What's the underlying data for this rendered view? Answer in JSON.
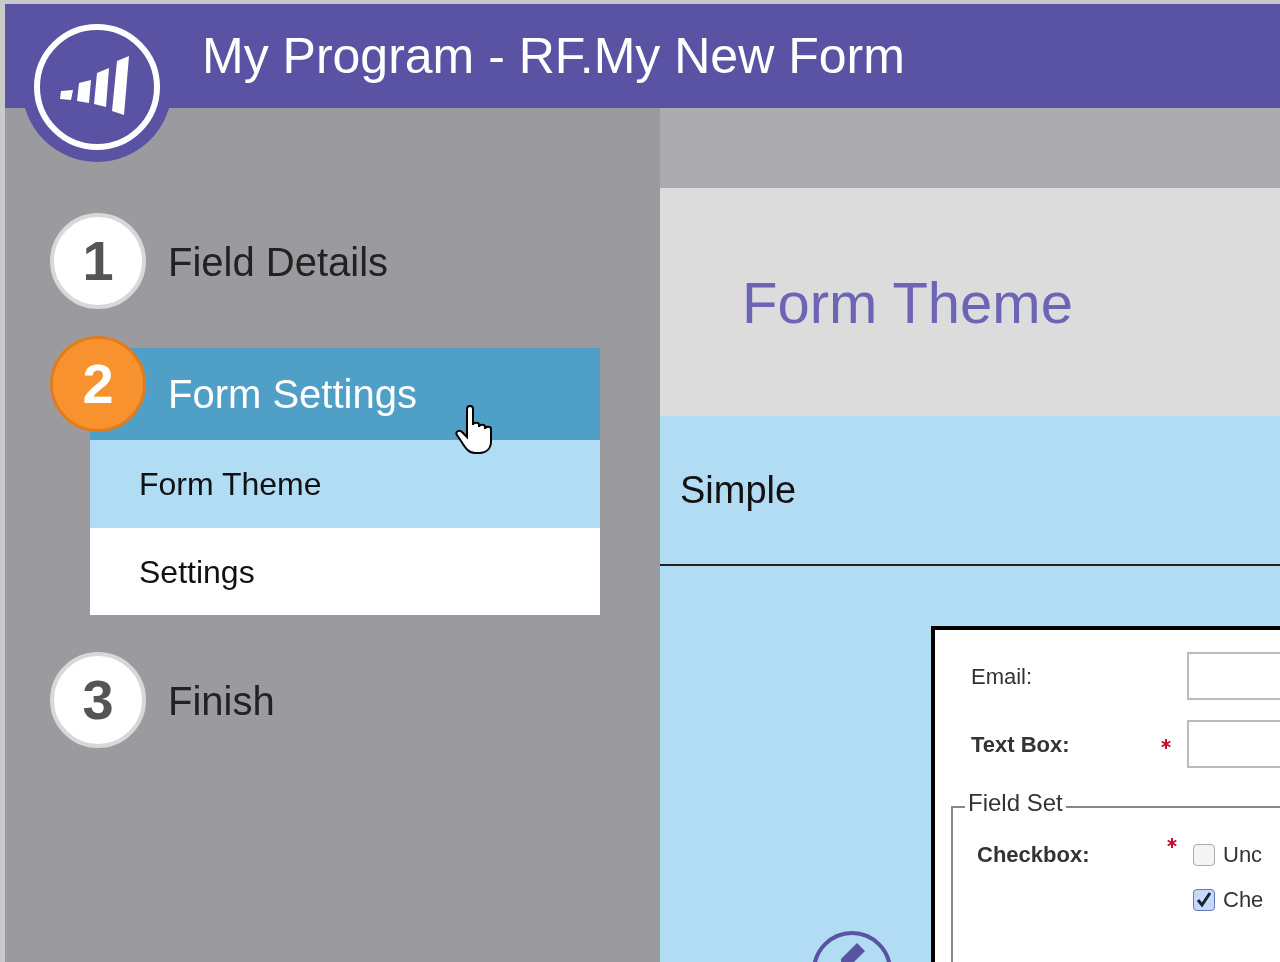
{
  "header": {
    "title": "My Program - RF.My New Form"
  },
  "steps": [
    {
      "number": "1",
      "label": "Field Details",
      "selected": false
    },
    {
      "number": "2",
      "label": "Form Settings",
      "selected": true,
      "children": [
        {
          "label": "Form Theme",
          "selected": true
        },
        {
          "label": "Settings",
          "selected": false
        }
      ]
    },
    {
      "number": "3",
      "label": "Finish",
      "selected": false
    }
  ],
  "panel": {
    "title": "Form Theme",
    "theme_name": "Simple"
  },
  "form_preview": {
    "fields": [
      {
        "label": "Email:",
        "required": false
      },
      {
        "label": "Text Box:",
        "required": true
      }
    ],
    "fieldset": {
      "legend": "Field Set",
      "label": "Checkbox:",
      "required": true,
      "options": [
        {
          "label": "Unc",
          "checked": false
        },
        {
          "label": "Che",
          "checked": true
        }
      ]
    }
  }
}
